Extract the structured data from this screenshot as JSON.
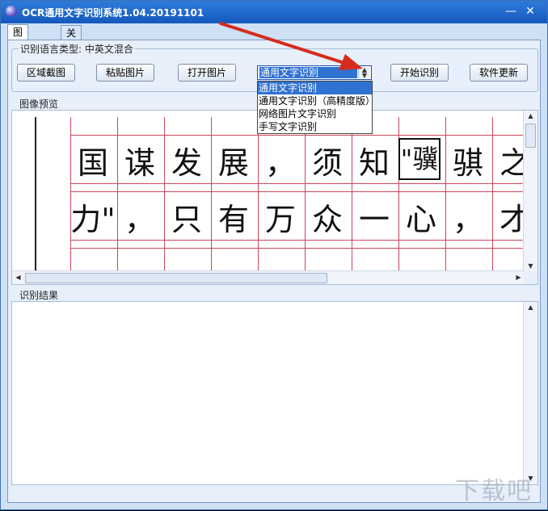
{
  "window": {
    "title": "OCR通用文字识别系统1.04.20191101",
    "minimize": "—",
    "close": "✕"
  },
  "tabs": [
    {
      "label": "图像识别"
    },
    {
      "label": "关于"
    }
  ],
  "language_group": {
    "legend": "识别语言类型: 中英文混合"
  },
  "buttons": {
    "region_capture": "区域截图",
    "paste_image": "粘贴图片",
    "open_image": "打开图片",
    "start_recognition": "开始识别",
    "software_update": "软件更新"
  },
  "mode_select": {
    "value": "通用文字识别",
    "options": [
      "通用文字识别",
      "通用文字识别（高精度版）",
      "网络图片文字识别",
      "手写文字识别"
    ]
  },
  "preview": {
    "legend": "图像预览",
    "rows": [
      [
        "国",
        "谋",
        "发",
        "展",
        "，",
        "须",
        "知",
        "\"骥",
        "骐",
        "之"
      ],
      [
        "力\"",
        "，",
        "只",
        "有",
        "万",
        "众",
        "一",
        "心",
        "，",
        "才"
      ]
    ]
  },
  "result": {
    "legend": "识别结果",
    "text": ""
  },
  "watermark": "下载吧",
  "colors": {
    "titlebar": "#1f67c8",
    "accent": "#3072d2",
    "grid_line": "#c9475c",
    "arrow": "#d62b1e"
  }
}
